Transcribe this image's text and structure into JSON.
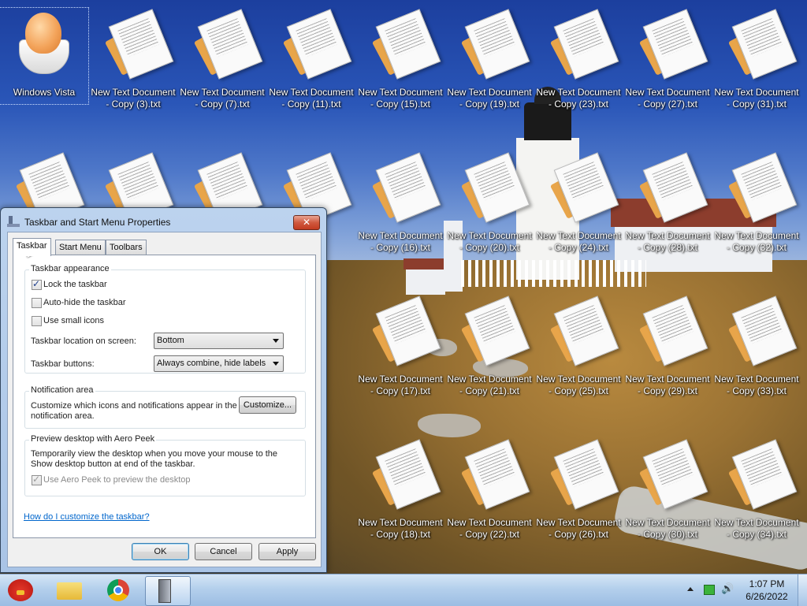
{
  "desktop": {
    "icons": [
      {
        "label": "Windows Vista"
      },
      {
        "label": "New Text Document - Copy (3).txt"
      },
      {
        "label": "New Text Document - Copy (7).txt"
      },
      {
        "label": "New Text Document - Copy (11).txt"
      },
      {
        "label": "New Text Document - Copy (15).txt"
      },
      {
        "label": "New Text Document - Copy (19).txt"
      },
      {
        "label": "New Text Document - Copy (23).txt"
      },
      {
        "label": "New Text Document - Copy (27).txt"
      },
      {
        "label": "New Text Document - Copy (31).txt"
      },
      {
        "label": "New Text Document - Copy (16).txt"
      },
      {
        "label": "New Text Document - Copy (20).txt"
      },
      {
        "label": "New Text Document - Copy (24).txt"
      },
      {
        "label": "New Text Document - Copy (28).txt"
      },
      {
        "label": "New Text Document - Copy (32).txt"
      },
      {
        "label": "New Text Document - Copy (17).txt"
      },
      {
        "label": "New Text Document - Copy (21).txt"
      },
      {
        "label": "New Text Document - Copy (25).txt"
      },
      {
        "label": "New Text Document - Copy (29).txt"
      },
      {
        "label": "New Text Document - Copy (33).txt"
      },
      {
        "label": "New Text Document - Copy (18).txt"
      },
      {
        "label": "New Text Document - Copy (22).txt"
      },
      {
        "label": "New Text Document - Copy (26).txt"
      },
      {
        "label": "New Text Document - Copy (30).txt"
      },
      {
        "label": "New Text Document - Copy (34).txt"
      }
    ]
  },
  "dialog": {
    "title": "Taskbar and Start Menu Properties",
    "close_glyph": "✕",
    "tabs": [
      {
        "label": "Taskbar",
        "active": true
      },
      {
        "label": "Start Menu",
        "active": false
      },
      {
        "label": "Toolbars",
        "active": false
      }
    ],
    "appearance": {
      "heading": "Taskbar appearance",
      "lock": {
        "label": "Lock the taskbar",
        "checked": true
      },
      "autohide": {
        "label": "Auto-hide the taskbar",
        "checked": false
      },
      "small_icons": {
        "label": "Use small icons",
        "checked": false
      },
      "location_label": "Taskbar location on screen:",
      "location_value": "Bottom",
      "buttons_label": "Taskbar buttons:",
      "buttons_value": "Always combine, hide labels"
    },
    "notification": {
      "heading": "Notification area",
      "text": "Customize which icons and notifications appear in the notification area.",
      "customize_button": "Customize..."
    },
    "peek": {
      "heading": "Preview desktop with Aero Peek",
      "text": "Temporarily view the desktop when you move your mouse to the Show desktop button at end of the taskbar.",
      "checkbox": {
        "label": "Use Aero Peek to preview the desktop",
        "checked": true,
        "disabled": true
      }
    },
    "help_link": "How do I customize the taskbar?",
    "buttons": {
      "ok": "OK",
      "cancel": "Cancel",
      "apply": "Apply"
    }
  },
  "taskbar": {
    "pinned": [
      {
        "name": "angry-birds-icon"
      },
      {
        "name": "windows-explorer-icon"
      },
      {
        "name": "chrome-icon"
      },
      {
        "name": "taskbar-properties-icon",
        "active": true
      }
    ],
    "tray": {
      "time": "1:07 PM",
      "date": "6/26/2022"
    }
  },
  "colors": {
    "accent": "#3c7fb1",
    "link": "#0066cc",
    "close": "#c23b20"
  }
}
